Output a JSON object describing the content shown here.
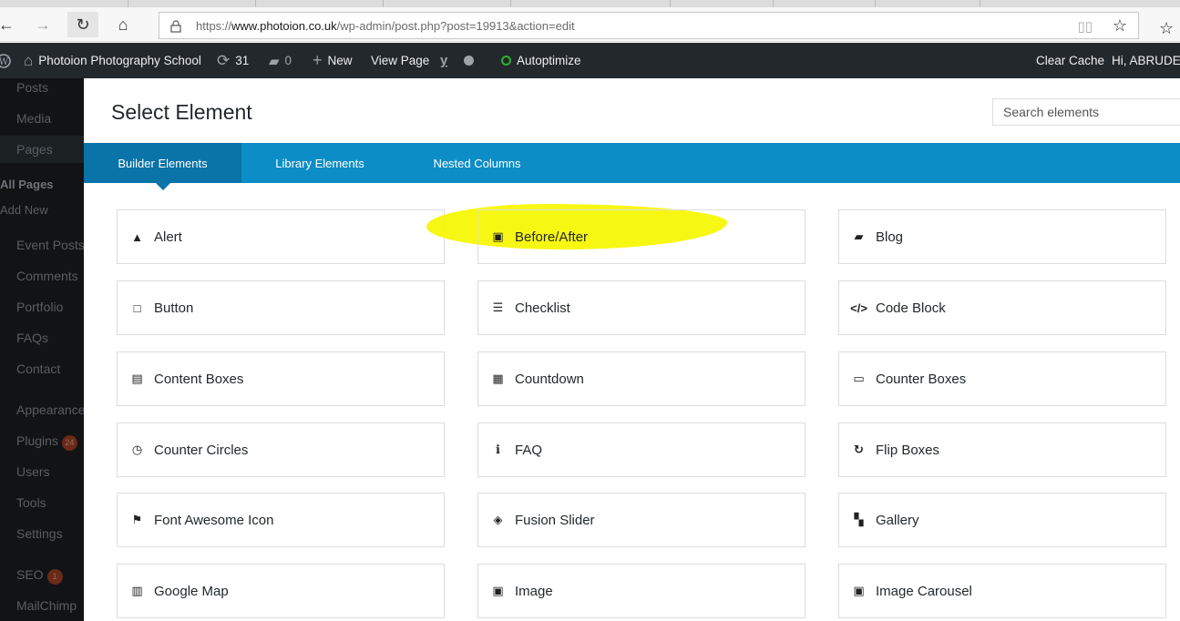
{
  "browser": {
    "back_icon": "arrow-left-icon",
    "url_scheme_host_prefix": "https://",
    "url_host": "www.photoion.co.uk",
    "url_path": "/wp-admin/post.php?post=19913&action=edit"
  },
  "adminbar": {
    "site_name": "Photoion Photography School",
    "updates_count": "31",
    "comments_count": "0",
    "new_label": "New",
    "view_page_label": "View Page",
    "autoptimize_label": "Autoptimize",
    "clear_cache_label": "Clear Cache",
    "greeting": "Hi, ABRUDEA"
  },
  "sidebar": {
    "items": [
      {
        "label": "Posts"
      },
      {
        "label": "Media"
      },
      {
        "label": "Pages"
      },
      {
        "label": "All Pages"
      },
      {
        "label": "Add New"
      },
      {
        "label": "Event Posts"
      },
      {
        "label": "Comments"
      },
      {
        "label": "Portfolio"
      },
      {
        "label": "FAQs"
      },
      {
        "label": "Contact"
      },
      {
        "label": "Appearance"
      },
      {
        "label": "Plugins",
        "badge": "24"
      },
      {
        "label": "Users"
      },
      {
        "label": "Tools"
      },
      {
        "label": "Settings"
      },
      {
        "label": "SEO",
        "badge": "1"
      },
      {
        "label": "MailChimp"
      }
    ]
  },
  "modal": {
    "title": "Select Element",
    "search_placeholder": "Search elements",
    "tabs": [
      {
        "label": "Builder Elements",
        "active": true
      },
      {
        "label": "Library Elements",
        "active": false
      },
      {
        "label": "Nested Columns",
        "active": false
      }
    ],
    "elements": [
      {
        "label": "Alert",
        "icon": "warning-icon",
        "glyph": "▲"
      },
      {
        "label": "Before/After",
        "icon": "image-icon",
        "glyph": "▣"
      },
      {
        "label": "Blog",
        "icon": "book-icon",
        "glyph": "▰"
      },
      {
        "label": "Button",
        "icon": "square-icon",
        "glyph": "□"
      },
      {
        "label": "Checklist",
        "icon": "list-icon",
        "glyph": "☰"
      },
      {
        "label": "Code Block",
        "icon": "code-icon",
        "glyph": "</>"
      },
      {
        "label": "Content Boxes",
        "icon": "content-boxes-icon",
        "glyph": "▤"
      },
      {
        "label": "Countdown",
        "icon": "calendar-check-icon",
        "glyph": "▦"
      },
      {
        "label": "Counter Boxes",
        "icon": "window-icon",
        "glyph": "▭"
      },
      {
        "label": "Counter Circles",
        "icon": "clock-icon",
        "glyph": "◷"
      },
      {
        "label": "FAQ",
        "icon": "info-icon",
        "glyph": "ℹ"
      },
      {
        "label": "Flip Boxes",
        "icon": "refresh-icon",
        "glyph": "↻"
      },
      {
        "label": "Font Awesome Icon",
        "icon": "flag-icon",
        "glyph": "⚑"
      },
      {
        "label": "Fusion Slider",
        "icon": "layers-icon",
        "glyph": "◈"
      },
      {
        "label": "Gallery",
        "icon": "grid-icon",
        "glyph": "▚"
      },
      {
        "label": "Google Map",
        "icon": "map-icon",
        "glyph": "▥"
      },
      {
        "label": "Image",
        "icon": "image-icon",
        "glyph": "▣"
      },
      {
        "label": "Image Carousel",
        "icon": "images-icon",
        "glyph": "▣"
      }
    ],
    "highlighted_element": "Before/After",
    "highlight_color": "#f6f600"
  },
  "colors": {
    "adminbar_bg": "#23282d",
    "tabs_bg": "#0d8dc5",
    "tab_active_bg": "#0a73a8"
  }
}
